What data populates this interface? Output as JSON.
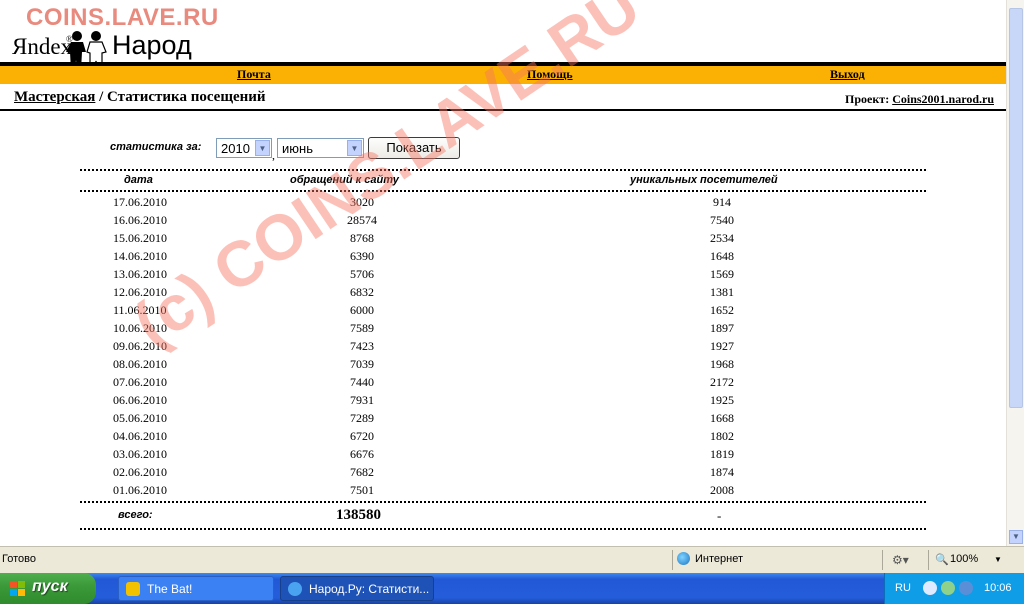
{
  "watermark": {
    "top": "COINS.LAVE.RU",
    "diagonal": "(c) COINS.LAVE.RU"
  },
  "logo": {
    "yandex": "Яndex",
    "reg": "®",
    "narod": "Народ"
  },
  "nav": {
    "mail": "Почта",
    "help": "Помощь",
    "exit": "Выход"
  },
  "breadcrumb": {
    "workshop": "Мастерская",
    "separator": " / ",
    "page": "Статистика посещений"
  },
  "project": {
    "label": "Проект:",
    "name": "Coins2001.narod.ru"
  },
  "form": {
    "label": "статистика за:",
    "year": "2010",
    "month": "июнь",
    "comma": ",",
    "submit": "Показать"
  },
  "table": {
    "headers": [
      "дата",
      "обращений к сайту",
      "уникальных посетителей"
    ],
    "rows": [
      [
        "17.06.2010",
        "3020",
        "914"
      ],
      [
        "16.06.2010",
        "28574",
        "7540"
      ],
      [
        "15.06.2010",
        "8768",
        "2534"
      ],
      [
        "14.06.2010",
        "6390",
        "1648"
      ],
      [
        "13.06.2010",
        "5706",
        "1569"
      ],
      [
        "12.06.2010",
        "6832",
        "1381"
      ],
      [
        "11.06.2010",
        "6000",
        "1652"
      ],
      [
        "10.06.2010",
        "7589",
        "1897"
      ],
      [
        "09.06.2010",
        "7423",
        "1927"
      ],
      [
        "08.06.2010",
        "7039",
        "1968"
      ],
      [
        "07.06.2010",
        "7440",
        "2172"
      ],
      [
        "06.06.2010",
        "7931",
        "1925"
      ],
      [
        "05.06.2010",
        "7289",
        "1668"
      ],
      [
        "04.06.2010",
        "6720",
        "1802"
      ],
      [
        "03.06.2010",
        "6676",
        "1819"
      ],
      [
        "02.06.2010",
        "7682",
        "1874"
      ],
      [
        "01.06.2010",
        "7501",
        "2008"
      ]
    ],
    "total_label": "всего:",
    "total_hits": "138580",
    "total_unique": "-"
  },
  "statusbar": {
    "status": "Готово",
    "zone": "Интернет",
    "zoom": "100%"
  },
  "taskbar": {
    "start": "пуск",
    "tasks": [
      "The Bat!",
      "Народ.Ру: Статисти..."
    ],
    "lang": "RU",
    "clock": "10:06"
  },
  "colors": {
    "accent_bar": "#fbb103",
    "watermark": "#f77662",
    "taskbar": "#245dda",
    "start": "#3c9a3a"
  }
}
